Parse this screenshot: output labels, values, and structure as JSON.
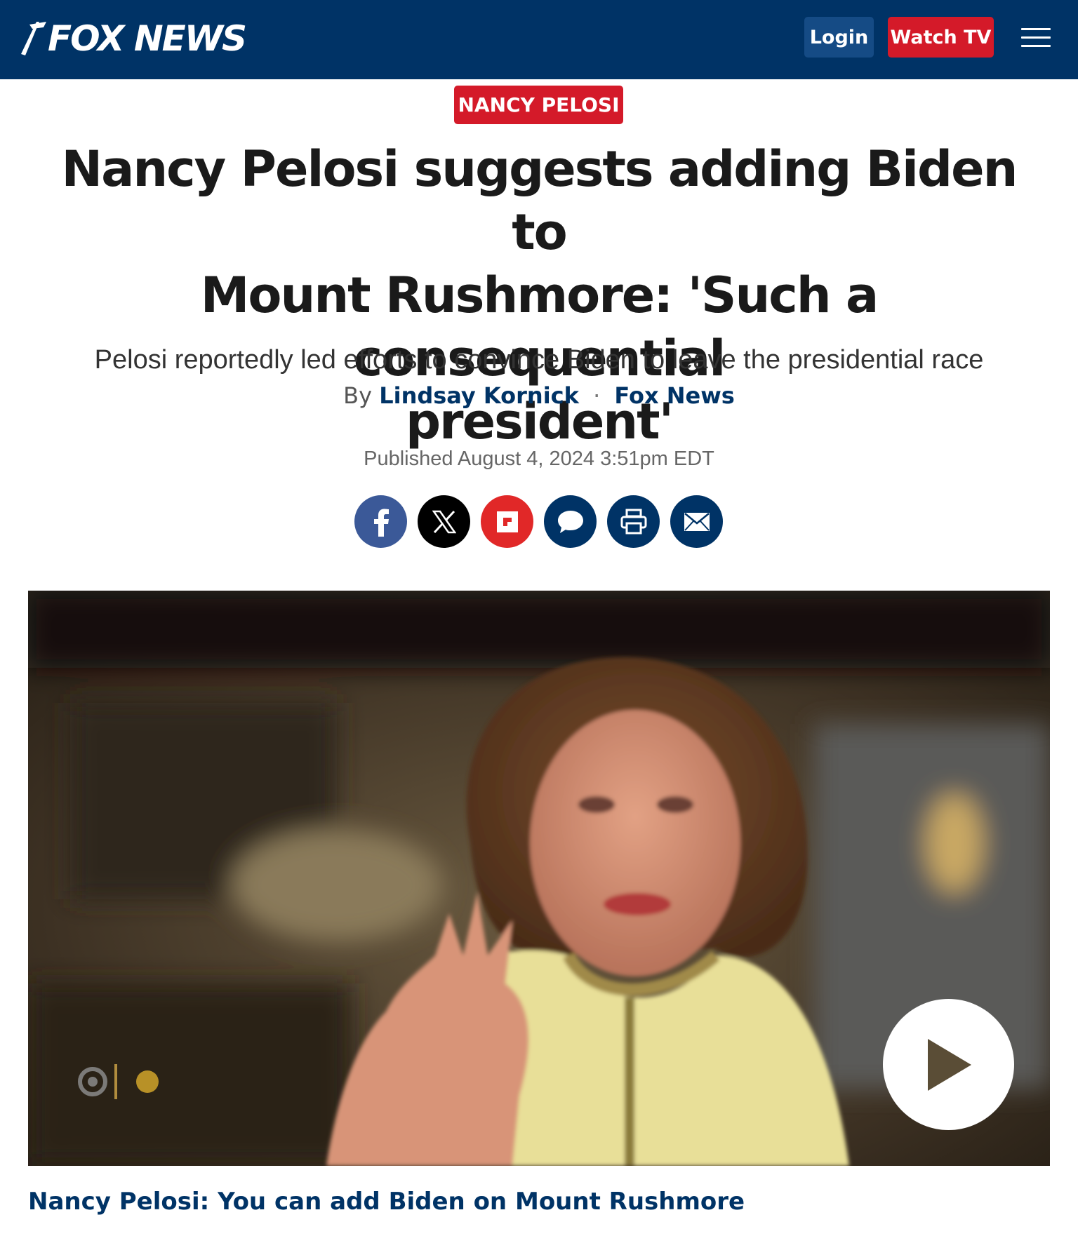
{
  "header": {
    "logo_text": "FOX NEWS",
    "login_label": "Login",
    "watch_label": "Watch TV",
    "colors": {
      "navy": "#003366",
      "red": "#d41a29"
    }
  },
  "article": {
    "category": "NANCY PELOSI",
    "headline_lines": [
      "Nancy Pelosi suggests adding Biden to",
      "Mount Rushmore: 'Such a consequential",
      "president'"
    ],
    "subhead": "Pelosi reportedly led efforts to convince Biden to leave the presidential race",
    "by": "By",
    "author": "Lindsay Kornick",
    "outlet": "Fox News",
    "published": "Published August 4, 2024 3:51pm EDT"
  },
  "share": [
    "facebook-icon",
    "x-icon",
    "flipboard-icon",
    "comment-icon",
    "print-icon",
    "email-icon"
  ],
  "video": {
    "caption": "Nancy Pelosi: You can add Biden on Mount Rushmore"
  }
}
